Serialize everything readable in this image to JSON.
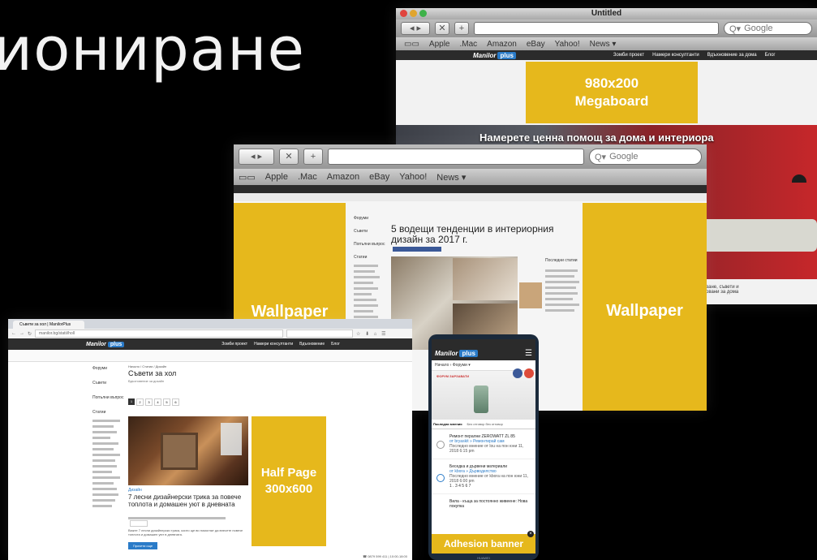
{
  "slide_title": "ионирaне",
  "back_window": {
    "title": "Untitled",
    "search_placeholder": "Google",
    "bookmarks": [
      "Apple",
      ".Mac",
      "Amazon",
      "eBay",
      "Yahoo!",
      "News ▾"
    ],
    "site_logo": "Manilor",
    "site_logo_badge": "plus",
    "nav_items": [
      "Зомби проект",
      "Намери консултанти",
      "Вдъхновение за дома",
      "Блог"
    ],
    "ad_label_1": "980x200",
    "ad_label_2": "Megaboard",
    "hero_text": "Намерете ценна помощ за дома и интериора",
    "caption_text": "ване, съвети и\nовани за дома"
  },
  "mid_window": {
    "search_placeholder": "Google",
    "bookmarks": [
      "Apple",
      ".Mac",
      "Amazon",
      "eBay",
      "Yahoo!",
      "News ▾"
    ],
    "wallpaper_left": "Wallpaper",
    "wallpaper_right": "Wallpaper",
    "article_title": "5 водещи тенденции в интериорния дизайн за 2017 г.",
    "sidebar_items": [
      "Форуми",
      "Съвети",
      "Попълни въпрос",
      "Статии"
    ],
    "related_heading": "Последни статии"
  },
  "front_window": {
    "tab_title": "Съвети за хол | ManilorPlus",
    "address": "manilor.bg/statii/holl",
    "site_logo": "Manilor",
    "site_logo_badge": "plus",
    "nav_items": [
      "Зомби проект",
      "Намери консултанти",
      "Вдъхновение",
      "Блог"
    ],
    "breadcrumb": "Начало / Статии / Дизайн",
    "page_heading": "Съвети за хол",
    "page_subheading": "Вдъхновение за дизайн",
    "sidebar_items": [
      "Форуми",
      "Съвети",
      "Попълни въпрос",
      "Статии"
    ],
    "pager": [
      "1",
      "2",
      "3",
      "4",
      "5",
      "6"
    ],
    "article_tag": "Дизайн",
    "article_title": "7 лесни дизайнерски трика за повече топлота и домашен уют в дневната",
    "article_excerpt": "Вижте 7 лесни дизайнерски трика, които ще ви помогнат да внесете повече топлота и домашен уют в дневната.",
    "read_more": "Прочети още",
    "ad_label_1": "Half Page",
    "ad_label_2": "300x600",
    "footer_phone": "☎ 0879 599 411 | 10:00-18:00"
  },
  "phone": {
    "site_logo": "Manilor",
    "site_logo_badge": "plus",
    "breadcrumb": "Начало › Форуми ▾",
    "forum_tag": "ФОРУМ ЗАРЗАВАТИ",
    "tabs": [
      "Последни мнения",
      "Без отговор без отговор"
    ],
    "posts": [
      {
        "title": "Ремонт перални ZEROWATT ZL 85",
        "meta": "от bryaskit » Ремонтирай сам",
        "last": "Последно мнение от lou на пон юни 11, 2018 6:15 pm"
      },
      {
        "title": "Беседка и дървени материали",
        "meta": "от kbora » Дърводелство",
        "last": "Последно мнение от kbora на пон юни 11, 2018 6:00 pm",
        "pages": "1 . 3 4 5 6 7"
      },
      {
        "title": "Вила - къща за постоянно живеене: Нова покупка",
        "meta": "",
        "last": ""
      }
    ],
    "ad_label": "Adhesion banner",
    "brand": "HUAWEI"
  },
  "colors": {
    "ad_yellow": "#e6b81c",
    "site_nav": "#2b2b2b",
    "wall_red": "#c6272a"
  }
}
